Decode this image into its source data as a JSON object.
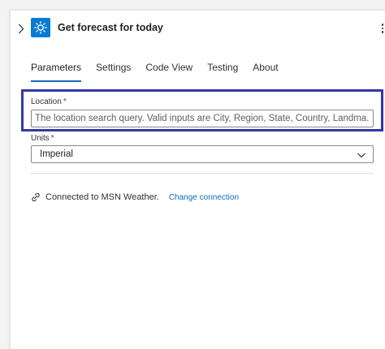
{
  "header": {
    "title": "Get forecast for today",
    "collapse_icon": "chevron-right-icon",
    "app_icon": "sun-icon",
    "app_icon_color": "#0a7bd4",
    "more_icon": "more-vertical-icon"
  },
  "tabs": [
    {
      "label": "Parameters",
      "active": true
    },
    {
      "label": "Settings",
      "active": false
    },
    {
      "label": "Code View",
      "active": false
    },
    {
      "label": "Testing",
      "active": false
    },
    {
      "label": "About",
      "active": false
    }
  ],
  "location": {
    "label": "Location",
    "required_mark": "*",
    "value": "",
    "placeholder": "The location search query. Valid inputs are City, Region, State, Country, Landma..."
  },
  "units": {
    "label": "Units",
    "required_mark": "*",
    "value": "Imperial"
  },
  "connection": {
    "text": "Connected to MSN Weather.",
    "link_label": "Change connection",
    "link_color": "#0f6cbd"
  },
  "colors": {
    "highlight_border": "#3337a8",
    "active_tab_underline": "#0f6cbd"
  }
}
